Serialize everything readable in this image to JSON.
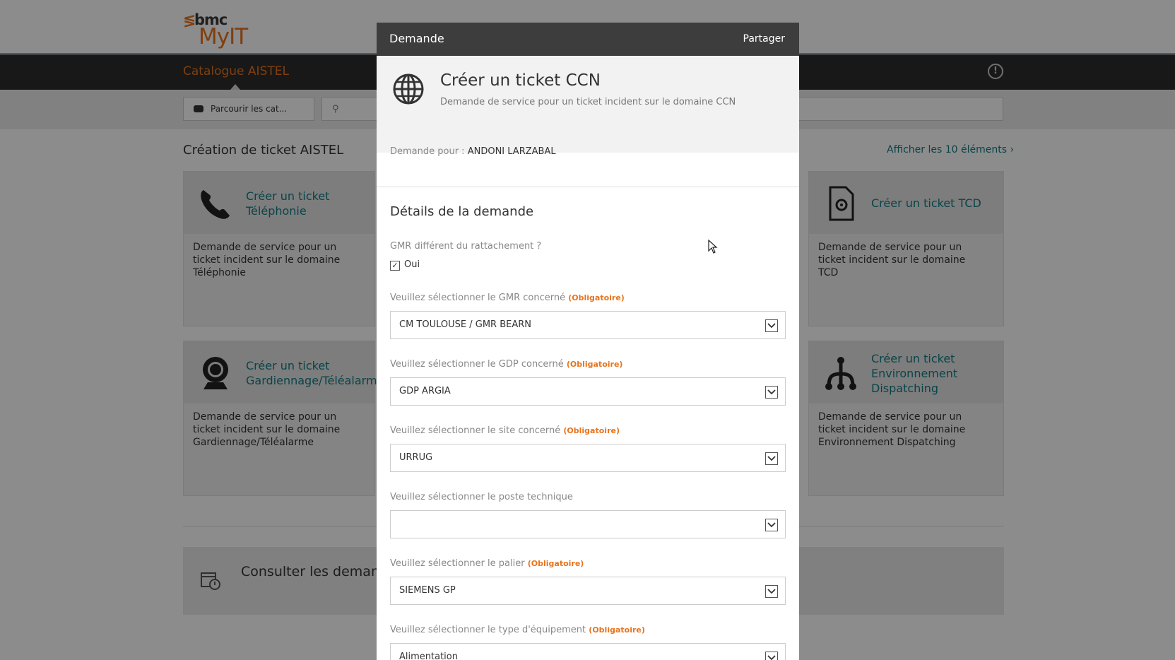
{
  "brand": {
    "company": "bmc",
    "product": "MyIT"
  },
  "nav": {
    "title": "Catalogue AISTEL"
  },
  "search": {
    "browse_label": "Parcourir les cat..."
  },
  "catalog": {
    "section_title": "Création de ticket AISTEL",
    "view_all": "Afficher les 10 éléments ›",
    "cards": [
      {
        "title": "Créer un ticket Téléphonie",
        "description": "Demande de service pour un ticket incident sur le domaine Téléphonie",
        "icon": "phone-icon"
      },
      {
        "title": "Créer un ticket TCD",
        "description": "Demande de service pour un ticket incident sur le domaine TCD",
        "icon": "gear-document-icon"
      },
      {
        "title": "Créer un ticket Gardiennage/Téléalarme",
        "description": "Demande de service pour un ticket incident sur le domaine Gardiennage/Téléalarme",
        "icon": "webcam-icon"
      },
      {
        "title": "Créer un ticket Environnement Dispatching",
        "description": "Demande de service pour un ticket incident sur le domaine Environnement Dispatching",
        "icon": "network-icon"
      }
    ],
    "consult_title": "Consulter les demande"
  },
  "modal": {
    "title": "Demande",
    "share": "Partager",
    "service_title": "Créer un ticket CCN",
    "service_desc": "Demande de service pour un ticket incident sur le domaine CCN",
    "request_for_label": "Demande pour : ",
    "request_for_value": "ANDONI LARZABAL",
    "details_title": "Détails de la demande",
    "gmr_question": "GMR différent du rattachement ?",
    "gmr_checkbox_label": "Oui",
    "required_tag": "(Obligatoire)",
    "fields": [
      {
        "label": "Veuillez sélectionner le GMR concerné",
        "required": true,
        "value": "CM TOULOUSE / GMR BEARN"
      },
      {
        "label": "Veuillez sélectionner le GDP concerné",
        "required": true,
        "value": "GDP ARGIA"
      },
      {
        "label": "Veuillez sélectionner le site concerné",
        "required": true,
        "value": "URRUG"
      },
      {
        "label": "Veuillez sélectionner le poste technique",
        "required": false,
        "value": ""
      },
      {
        "label": "Veuillez sélectionner le palier",
        "required": true,
        "value": "SIEMENS GP"
      },
      {
        "label": "Veuillez sélectionner le type d'équipement",
        "required": true,
        "value": "Alimentation"
      }
    ]
  },
  "colors": {
    "accent": "#e8731c",
    "link": "#137d84",
    "header": "#3d3d3d"
  }
}
